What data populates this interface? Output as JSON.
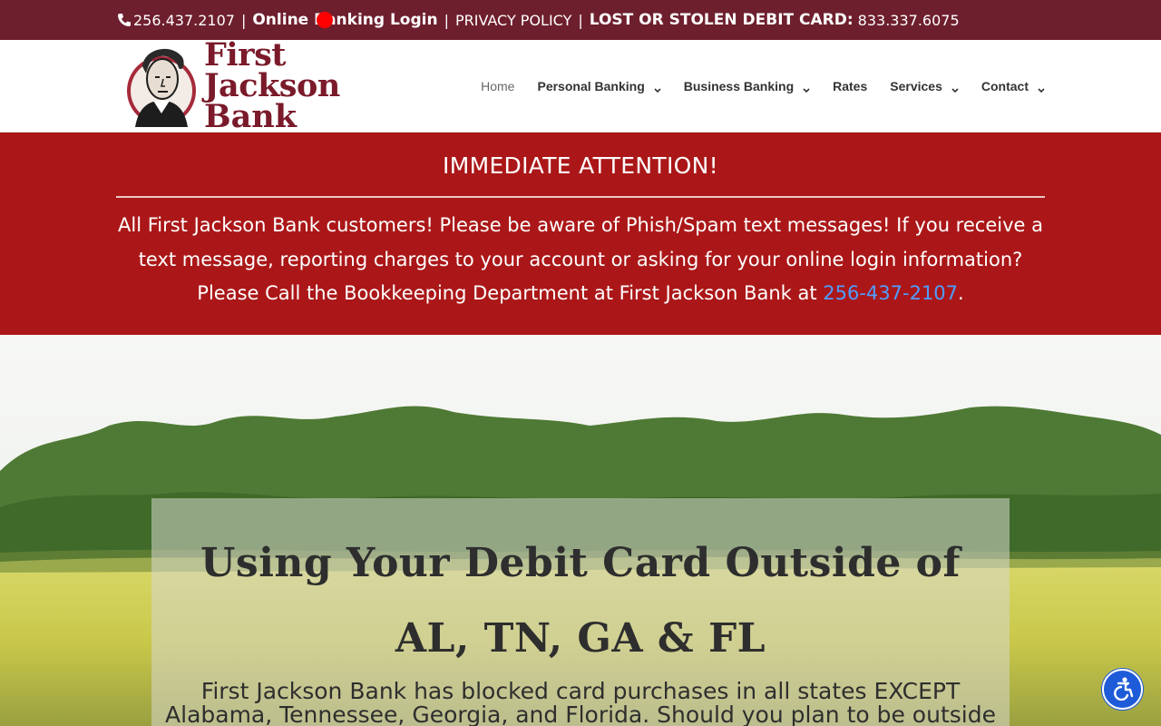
{
  "topbar": {
    "phone": "256.437.2107",
    "sep1": "|",
    "online_banking": "Online Banking Login",
    "sep2": "|",
    "privacy": "PRIVACY POLICY",
    "sep3": "|",
    "lost_label": "LOST OR STOLEN DEBIT CARD:",
    "lost_phone": "833.337.6075",
    "bg_color": "#6e1f2e"
  },
  "header": {
    "logo_line1": "First Jackson",
    "logo_line2": "Bank",
    "brand_color": "#7a1a2a"
  },
  "nav": {
    "items": [
      {
        "label": "Home",
        "active": true,
        "dropdown": false
      },
      {
        "label": "Personal Banking",
        "active": false,
        "dropdown": true
      },
      {
        "label": "Business Banking",
        "active": false,
        "dropdown": true
      },
      {
        "label": "Rates",
        "active": false,
        "dropdown": false
      },
      {
        "label": "Services",
        "active": false,
        "dropdown": true
      },
      {
        "label": "Contact",
        "active": false,
        "dropdown": true
      }
    ]
  },
  "alert": {
    "title": "IMMEDIATE ATTENTION!",
    "body_before": "All First Jackson Bank customers!  Please be aware of Phish/Spam text messages!  If you receive a text message, reporting charges to your account or asking for your online login information?  Please Call the Bookkeeping Department at First Jackson Bank at ",
    "phone": "256-437-2107",
    "body_after": ".",
    "bg_color": "#ab1718",
    "link_color": "#4f9dff"
  },
  "hero": {
    "title": "Using Your Debit Card Outside of AL, TN, GA & FL",
    "body": "First Jackson Bank has blocked card purchases in all states EXCEPT Alabama, Tennessee, Georgia, and Florida. Should you plan to be outside"
  },
  "accessibility": {
    "icon": "accessibility-icon",
    "color": "#1e5bd8"
  }
}
